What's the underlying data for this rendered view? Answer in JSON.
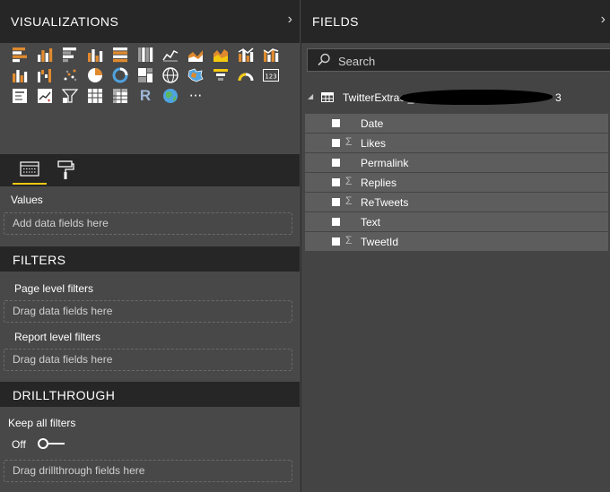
{
  "visualizations": {
    "title": "VISUALIZATIONS",
    "collapse_glyph": "›",
    "icons": [
      "stacked-bar-chart-icon",
      "stacked-column-chart-icon",
      "clustered-bar-chart-icon",
      "clustered-column-chart-icon",
      "100-percent-stacked-bar-chart-icon",
      "100-percent-stacked-column-chart-icon",
      "line-chart-icon",
      "area-chart-icon",
      "stacked-area-chart-icon",
      "line-and-stacked-column-chart-icon",
      "line-and-clustered-column-chart-icon",
      "ribbon-chart-icon",
      "waterfall-chart-icon",
      "scatter-chart-icon",
      "pie-chart-icon",
      "donut-chart-icon",
      "treemap-icon",
      "map-icon",
      "filled-map-icon",
      "funnel-icon",
      "gauge-icon",
      "card-icon",
      "multi-row-card-icon",
      "kpi-icon",
      "slicer-icon",
      "table-icon",
      "matrix-icon",
      "r-script-visual-icon",
      "arcgis-map-icon",
      "more-visuals-icon"
    ],
    "r_glyph": "R",
    "more_glyph": "···",
    "tabs": {
      "fields": "fields-tab",
      "format": "format-tab"
    },
    "values_label": "Values",
    "values_placeholder": "Add data fields here"
  },
  "filters": {
    "title": "FILTERS",
    "page_level_label": "Page level filters",
    "page_level_placeholder": "Drag data fields here",
    "report_level_label": "Report level filters",
    "report_level_placeholder": "Drag data fields here"
  },
  "drillthrough": {
    "title": "DRILLTHROUGH",
    "keep_all_filters_label": "Keep all filters",
    "toggle_state": "Off",
    "placeholder": "Drag drillthrough fields here"
  },
  "fields_pane": {
    "title": "FIELDS",
    "collapse_glyph": "›",
    "search_placeholder": "Search",
    "table": {
      "expand_glyph": "◢",
      "name": "TwitterExtract_",
      "name_tail": "3",
      "fields": [
        {
          "name": "Date",
          "sigma": ""
        },
        {
          "name": "Likes",
          "sigma": "Σ"
        },
        {
          "name": "Permalink",
          "sigma": ""
        },
        {
          "name": "Replies",
          "sigma": "Σ"
        },
        {
          "name": "ReTweets",
          "sigma": "Σ"
        },
        {
          "name": "Text",
          "sigma": ""
        },
        {
          "name": "TweetId",
          "sigma": "Σ"
        }
      ]
    }
  },
  "colors": {
    "accent": "#f2c811",
    "panel_dark": "#262626",
    "panel_mid": "#484848",
    "field_row": "#5d5d5d"
  }
}
